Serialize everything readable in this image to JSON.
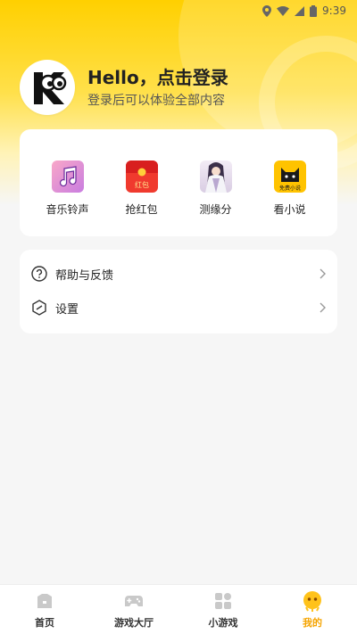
{
  "status_bar": {
    "time": "9:39"
  },
  "profile": {
    "title": "Hello，点击登录",
    "subtitle": "登录后可以体验全部内容"
  },
  "apps": [
    {
      "label": "音乐铃声",
      "icon": "music-note-icon"
    },
    {
      "label": "抢红包",
      "icon": "red-envelope-icon",
      "icon_text": "红包"
    },
    {
      "label": "测缘分",
      "icon": "fortune-girl-icon"
    },
    {
      "label": "看小说",
      "icon": "novel-cat-icon",
      "icon_text": "免费小说"
    }
  ],
  "menu": [
    {
      "label": "帮助与反馈",
      "icon": "help-icon"
    },
    {
      "label": "设置",
      "icon": "settings-icon"
    }
  ],
  "tabbar": {
    "tabs": [
      {
        "label": "首页",
        "icon": "home-icon"
      },
      {
        "label": "游戏大厅",
        "icon": "gamepad-icon"
      },
      {
        "label": "小游戏",
        "icon": "mini-game-icon"
      },
      {
        "label": "我的",
        "icon": "profile-icon"
      }
    ],
    "active_index": 3
  },
  "colors": {
    "accent": "#ffd000",
    "active_tab": "#f5a400"
  }
}
